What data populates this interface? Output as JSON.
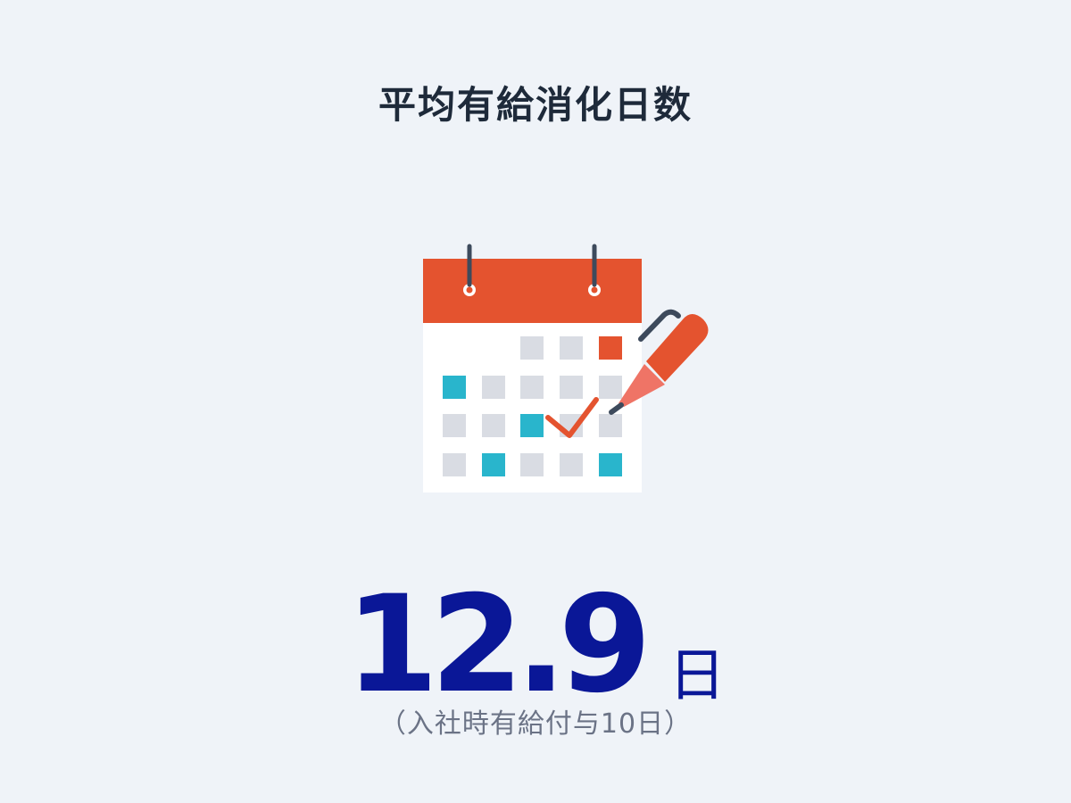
{
  "title": "平均有給消化日数",
  "value": {
    "number": "12.9",
    "unit": "日"
  },
  "note": "（入社時有給付与10日）",
  "illustration": {
    "icon": "calendar-with-pen-icon",
    "colors": {
      "header": "#e4532f",
      "highlight": "#29b5cc",
      "cell": "#d9dce3",
      "pen": "#e4532f",
      "pen_tip": "#ef7466",
      "ring": "#3d4a5c",
      "check": "#e4532f"
    }
  },
  "colors": {
    "background": "#eff3f8",
    "title": "#1e2a3a",
    "value": "#0a1797",
    "note": "#6b7386"
  }
}
